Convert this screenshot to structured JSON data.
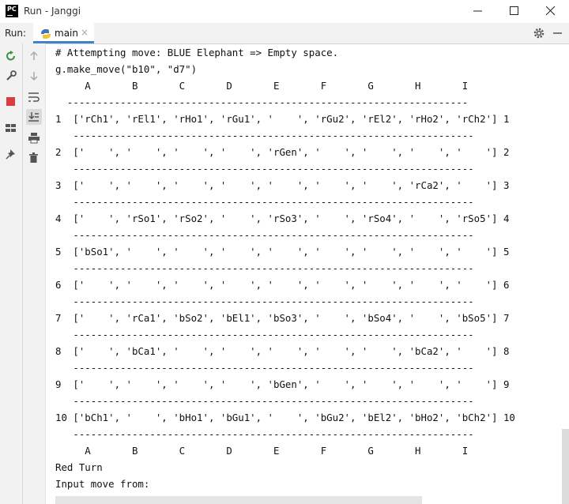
{
  "window": {
    "title": "Run - Janggi",
    "logo_text": "PC"
  },
  "runbar": {
    "label": "Run:",
    "tab_label": "main",
    "tab_close": "×"
  },
  "console": {
    "lines": [
      "# Attempting move: BLUE Elephant => Empty space.",
      "g.make_move(\"b10\", \"d7\")",
      "     A       B       C       D       E       F       G       H       I",
      "  --------------------------------------------------------------------",
      "1  ['rCh1', 'rEl1', 'rHo1', 'rGu1', '    ', 'rGu2', 'rEl2', 'rHo2', 'rCh2'] 1",
      "   --------------------------------------------------------------------",
      "2  ['    ', '    ', '    ', '    ', 'rGen', '    ', '    ', '    ', '    '] 2",
      "   --------------------------------------------------------------------",
      "3  ['    ', '    ', '    ', '    ', '    ', '    ', '    ', 'rCa2', '    '] 3",
      "   --------------------------------------------------------------------",
      "4  ['    ', 'rSo1', 'rSo2', '    ', 'rSo3', '    ', 'rSo4', '    ', 'rSo5'] 4",
      "   --------------------------------------------------------------------",
      "5  ['bSo1', '    ', '    ', '    ', '    ', '    ', '    ', '    ', '    '] 5",
      "   --------------------------------------------------------------------",
      "6  ['    ', '    ', '    ', '    ', '    ', '    ', '    ', '    ', '    '] 6",
      "   --------------------------------------------------------------------",
      "7  ['    ', 'rCa1', 'bSo2', 'bEl1', 'bSo3', '    ', 'bSo4', '    ', 'bSo5'] 7",
      "   --------------------------------------------------------------------",
      "8  ['    ', 'bCa1', '    ', '    ', '    ', '    ', '    ', 'bCa2', '    '] 8",
      "   --------------------------------------------------------------------",
      "9  ['    ', '    ', '    ', '    ', 'bGen', '    ', '    ', '    ', '    '] 9",
      "   --------------------------------------------------------------------",
      "10 ['bCh1', '    ', 'bHo1', 'bGu1', '    ', 'bGu2', 'bEl2', 'bHo2', 'bCh2'] 10",
      "   --------------------------------------------------------------------",
      "     A       B       C       D       E       F       G       H       I",
      "Red Turn",
      "Input move from:"
    ]
  },
  "colors": {
    "accent": "#4083c9",
    "rerun": "#3d9140",
    "stop": "#db3b3b"
  }
}
